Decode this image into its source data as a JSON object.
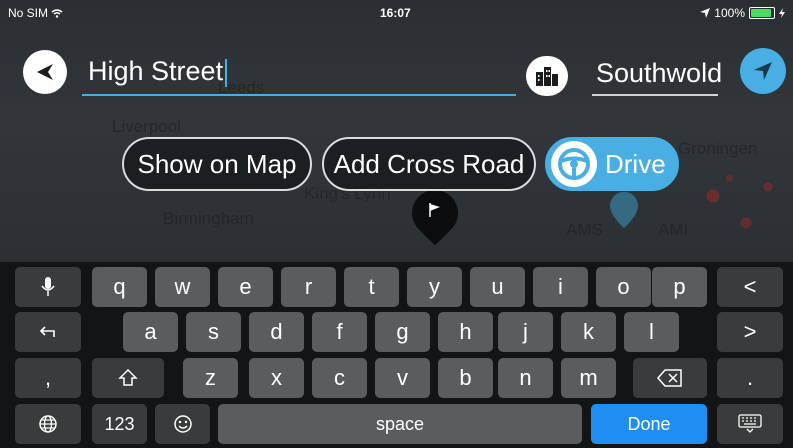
{
  "status": {
    "carrier": "No SIM",
    "time": "16:07",
    "battery": "100%"
  },
  "search": {
    "query": "High Street",
    "city": "Southwold"
  },
  "map": {
    "labels": [
      "Leeds",
      "Liverpool",
      "King's Lynn",
      "Birmingham",
      "Groningen",
      "AMS",
      "AMI"
    ]
  },
  "actions": {
    "show_on_map": "Show on Map",
    "add_cross_road": "Add Cross Road",
    "drive": "Drive"
  },
  "keyboard": {
    "row1": [
      "q",
      "w",
      "e",
      "r",
      "t",
      "y",
      "u",
      "i",
      "o",
      "p"
    ],
    "row2": [
      "a",
      "s",
      "d",
      "f",
      "g",
      "h",
      "j",
      "k",
      "l"
    ],
    "row3": [
      "z",
      "x",
      "c",
      "v",
      "b",
      "n",
      "m"
    ],
    "back_key": "<",
    "forward_key": ">",
    "comma_key": ",",
    "period_key": ".",
    "numbers_key": "123",
    "space_key": "space",
    "done_key": "Done"
  },
  "colors": {
    "accent": "#48aee3",
    "done": "#1e8ef2",
    "key": "#5a5c5e",
    "keyboard_bg": "#131415"
  }
}
